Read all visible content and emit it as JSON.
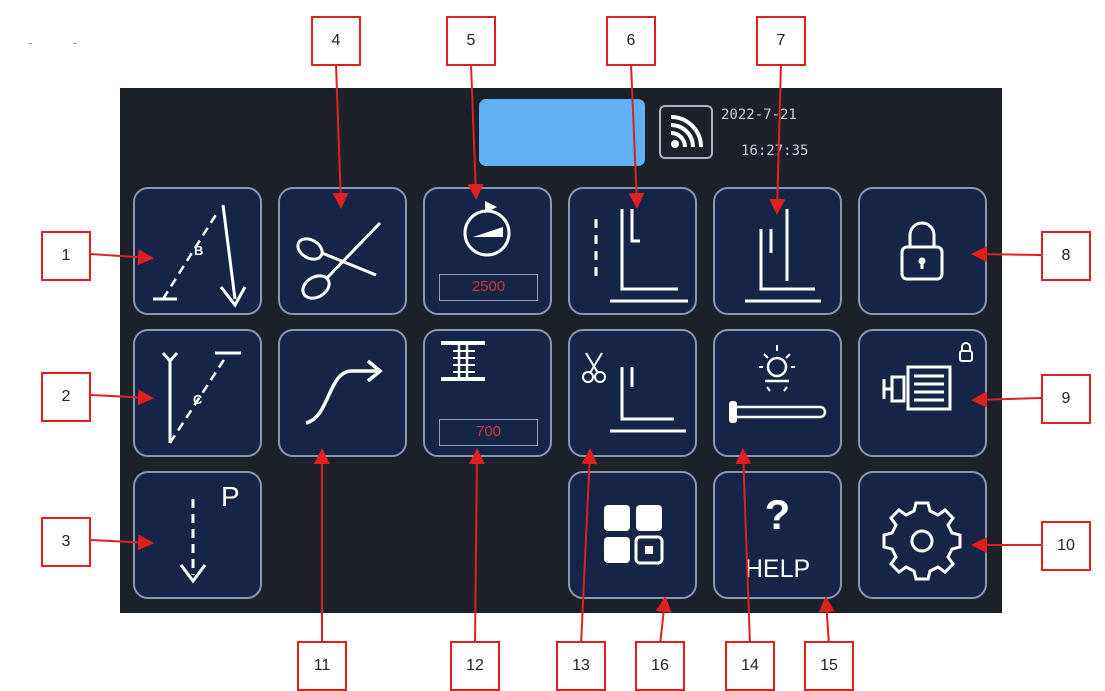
{
  "header": {
    "date": "2022-7-21",
    "time": "16:27:35"
  },
  "buttons": {
    "thread_trimmer_counter_value": "2500",
    "stitch_counter_value": "700",
    "help_label": "HELP",
    "help_symbol": "?",
    "backtack_b_letter": "B",
    "backtack_c_letter": "C",
    "needle_stop_letter": "P"
  },
  "callouts": [
    "1",
    "2",
    "3",
    "4",
    "5",
    "6",
    "7",
    "8",
    "9",
    "10",
    "11",
    "12",
    "13",
    "14",
    "15",
    "16"
  ],
  "colors": {
    "panel": "#1c2028",
    "button": "#152447",
    "display": "#60b0f4",
    "callout_border": "#e02020",
    "value_text": "#c83a3a"
  },
  "icons": [
    "backtack-b-icon",
    "backtack-c-icon",
    "needle-down-p-icon",
    "scissors-icon",
    "counter-dial-icon",
    "presser-foot-lift-icon",
    "needle-position-icon",
    "lock-icon",
    "motor-icon",
    "gear-icon",
    "soft-start-curve-icon",
    "stitch-count-icon",
    "trim-foot-icon",
    "light-icon",
    "help-icon",
    "apps-icon",
    "wifi-icon"
  ]
}
